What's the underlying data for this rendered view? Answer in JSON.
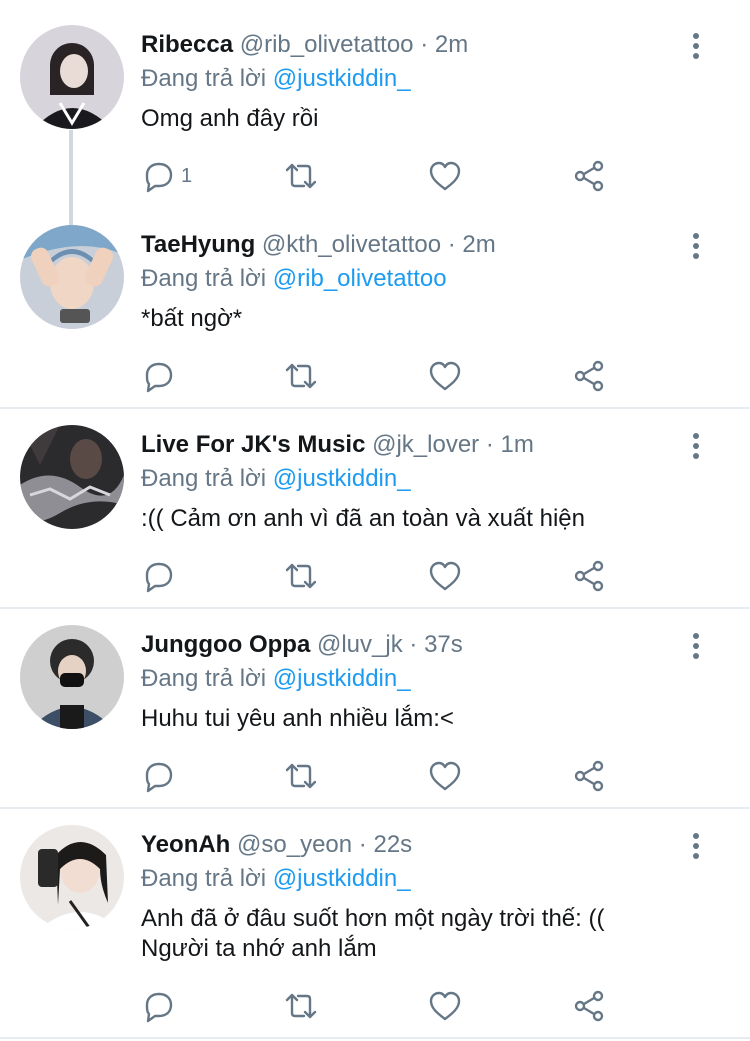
{
  "reply_prefix": "Đang trả lời",
  "tweets": [
    {
      "name": "Ribecca",
      "handle": "@rib_olivetattoo",
      "dot": "·",
      "time": "2m",
      "reply_to": "@justkiddin_",
      "text": "Omg anh đây rồi",
      "reply_count": "1"
    },
    {
      "name": "TaeHyung",
      "handle": "@kth_olivetattoo",
      "dot": "·",
      "time": "2m",
      "reply_to": "@rib_olivetattoo",
      "text": "*bất ngờ*",
      "reply_count": ""
    },
    {
      "name": "Live For JK's Music",
      "handle": "@jk_lover",
      "dot": "·",
      "time": "1m",
      "reply_to": "@justkiddin_",
      "text": ":(( Cảm ơn anh vì đã an toàn và xuất hiện",
      "reply_count": ""
    },
    {
      "name": "Junggoo Oppa",
      "handle": "@luv_jk",
      "dot": "·",
      "time": "37s",
      "reply_to": "@justkiddin_",
      "text": "Huhu tui yêu anh nhiều lắm:<",
      "reply_count": ""
    },
    {
      "name": "YeonAh",
      "handle": "@so_yeon",
      "dot": "·",
      "time": "22s",
      "reply_to": "@justkiddin_",
      "text": "Anh đã ở đâu suốt hơn một ngày trời thế: (( Người ta nhớ anh lắm",
      "reply_count": ""
    }
  ],
  "colors": {
    "accent": "#1d9bf0",
    "muted": "#657786",
    "text": "#14171a",
    "divider": "#e6ecf0"
  },
  "icons": [
    "reply-icon",
    "retweet-icon",
    "like-icon",
    "share-icon",
    "more-icon"
  ]
}
